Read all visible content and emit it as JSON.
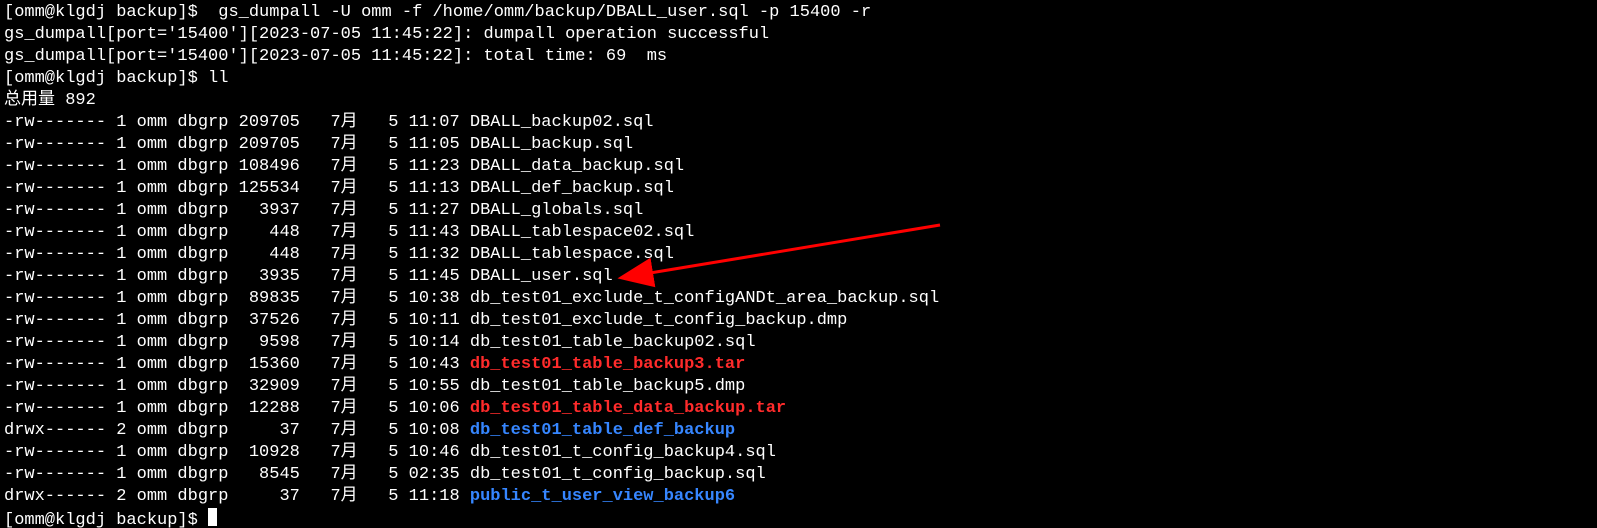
{
  "prompt1_user": "[omm@klgdj backup]$",
  "prompt1_cmd": "  gs_dumpall -U omm -f /home/omm/backup/DBALL_user.sql -p 15400 -r",
  "out1": "gs_dumpall[port='15400'][2023-07-05 11:45:22]: dumpall operation successful",
  "out2": "gs_dumpall[port='15400'][2023-07-05 11:45:22]: total time: 69  ms",
  "prompt2_user": "[omm@klgdj backup]$",
  "prompt2_cmd": " ll",
  "total_line": "总用量 892",
  "files": [
    {
      "perm": "-rw-------",
      "links": "1",
      "owner": "omm",
      "group": "dbgrp",
      "size": "209705",
      "month": "7月",
      "day": "5",
      "time": "11:07",
      "name": "DBALL_backup02.sql",
      "cls": ""
    },
    {
      "perm": "-rw-------",
      "links": "1",
      "owner": "omm",
      "group": "dbgrp",
      "size": "209705",
      "month": "7月",
      "day": "5",
      "time": "11:05",
      "name": "DBALL_backup.sql",
      "cls": ""
    },
    {
      "perm": "-rw-------",
      "links": "1",
      "owner": "omm",
      "group": "dbgrp",
      "size": "108496",
      "month": "7月",
      "day": "5",
      "time": "11:23",
      "name": "DBALL_data_backup.sql",
      "cls": ""
    },
    {
      "perm": "-rw-------",
      "links": "1",
      "owner": "omm",
      "group": "dbgrp",
      "size": "125534",
      "month": "7月",
      "day": "5",
      "time": "11:13",
      "name": "DBALL_def_backup.sql",
      "cls": ""
    },
    {
      "perm": "-rw-------",
      "links": "1",
      "owner": "omm",
      "group": "dbgrp",
      "size": "3937",
      "month": "7月",
      "day": "5",
      "time": "11:27",
      "name": "DBALL_globals.sql",
      "cls": ""
    },
    {
      "perm": "-rw-------",
      "links": "1",
      "owner": "omm",
      "group": "dbgrp",
      "size": "448",
      "month": "7月",
      "day": "5",
      "time": "11:43",
      "name": "DBALL_tablespace02.sql",
      "cls": ""
    },
    {
      "perm": "-rw-------",
      "links": "1",
      "owner": "omm",
      "group": "dbgrp",
      "size": "448",
      "month": "7月",
      "day": "5",
      "time": "11:32",
      "name": "DBALL_tablespace.sql",
      "cls": ""
    },
    {
      "perm": "-rw-------",
      "links": "1",
      "owner": "omm",
      "group": "dbgrp",
      "size": "3935",
      "month": "7月",
      "day": "5",
      "time": "11:45",
      "name": "DBALL_user.sql",
      "cls": ""
    },
    {
      "perm": "-rw-------",
      "links": "1",
      "owner": "omm",
      "group": "dbgrp",
      "size": "89835",
      "month": "7月",
      "day": "5",
      "time": "10:38",
      "name": "db_test01_exclude_t_configANDt_area_backup.sql",
      "cls": ""
    },
    {
      "perm": "-rw-------",
      "links": "1",
      "owner": "omm",
      "group": "dbgrp",
      "size": "37526",
      "month": "7月",
      "day": "5",
      "time": "10:11",
      "name": "db_test01_exclude_t_config_backup.dmp",
      "cls": ""
    },
    {
      "perm": "-rw-------",
      "links": "1",
      "owner": "omm",
      "group": "dbgrp",
      "size": "9598",
      "month": "7月",
      "day": "5",
      "time": "10:14",
      "name": "db_test01_table_backup02.sql",
      "cls": ""
    },
    {
      "perm": "-rw-------",
      "links": "1",
      "owner": "omm",
      "group": "dbgrp",
      "size": "15360",
      "month": "7月",
      "day": "5",
      "time": "10:43",
      "name": "db_test01_table_backup3.tar",
      "cls": "red"
    },
    {
      "perm": "-rw-------",
      "links": "1",
      "owner": "omm",
      "group": "dbgrp",
      "size": "32909",
      "month": "7月",
      "day": "5",
      "time": "10:55",
      "name": "db_test01_table_backup5.dmp",
      "cls": ""
    },
    {
      "perm": "-rw-------",
      "links": "1",
      "owner": "omm",
      "group": "dbgrp",
      "size": "12288",
      "month": "7月",
      "day": "5",
      "time": "10:06",
      "name": "db_test01_table_data_backup.tar",
      "cls": "red"
    },
    {
      "perm": "drwx------",
      "links": "2",
      "owner": "omm",
      "group": "dbgrp",
      "size": "37",
      "month": "7月",
      "day": "5",
      "time": "10:08",
      "name": "db_test01_table_def_backup",
      "cls": "blue"
    },
    {
      "perm": "-rw-------",
      "links": "1",
      "owner": "omm",
      "group": "dbgrp",
      "size": "10928",
      "month": "7月",
      "day": "5",
      "time": "10:46",
      "name": "db_test01_t_config_backup4.sql",
      "cls": ""
    },
    {
      "perm": "-rw-------",
      "links": "1",
      "owner": "omm",
      "group": "dbgrp",
      "size": "8545",
      "month": "7月",
      "day": "5",
      "time": "02:35",
      "name": "db_test01_t_config_backup.sql",
      "cls": ""
    },
    {
      "perm": "drwx------",
      "links": "2",
      "owner": "omm",
      "group": "dbgrp",
      "size": "37",
      "month": "7月",
      "day": "5",
      "time": "11:18",
      "name": "public_t_user_view_backup6",
      "cls": "blue"
    }
  ],
  "prompt3_user": "[omm@klgdj backup]$",
  "prompt3_cmd": " "
}
